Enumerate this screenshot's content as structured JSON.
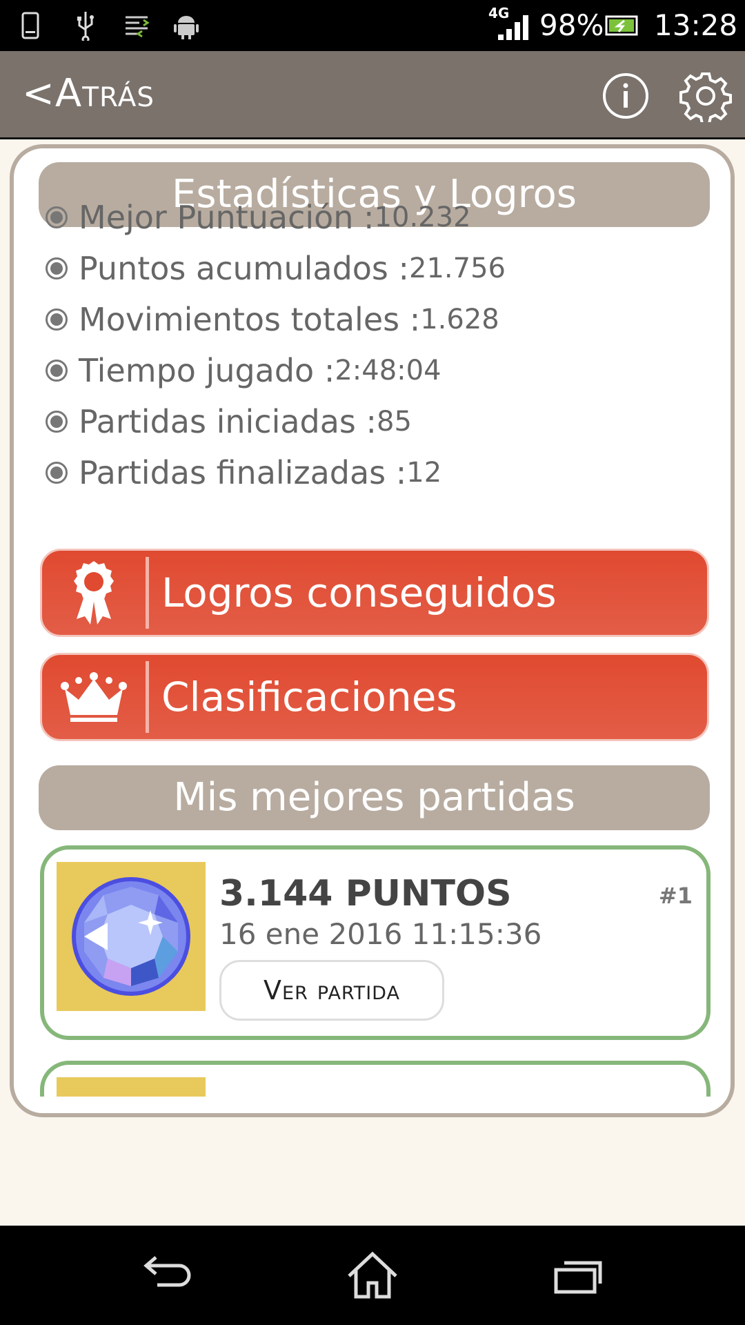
{
  "status": {
    "network": "4G",
    "battery": "98%",
    "time": "13:28"
  },
  "appbar": {
    "back_label": "<Atrás",
    "info_icon": "info-icon",
    "settings_icon": "gear-icon"
  },
  "stats": {
    "title": "Estadísticas y Logros",
    "items": [
      {
        "label": "Mejor Puntuación : ",
        "value": "10.232"
      },
      {
        "label": "Puntos acumulados : ",
        "value": "21.756"
      },
      {
        "label": "Movimientos totales : ",
        "value": "1.628"
      },
      {
        "label": "Tiempo jugado : ",
        "value": "2:48:04"
      },
      {
        "label": "Partidas iniciadas : ",
        "value": "85"
      },
      {
        "label": "Partidas finalizadas : ",
        "value": "12"
      }
    ]
  },
  "buttons": {
    "achievements": "Logros conseguidos",
    "rankings": "Clasificaciones"
  },
  "best": {
    "title": "Mis mejores partidas",
    "games": [
      {
        "points": "3.144 PUNTOS",
        "date": "16 ene 2016  11:15:36",
        "rank": "#1",
        "view": "Ver partida"
      }
    ]
  },
  "colors": {
    "appbar": "#7a726b",
    "header": "#b8aca0",
    "accent_red": "#e04a30",
    "card_border_green": "#86b77a"
  }
}
